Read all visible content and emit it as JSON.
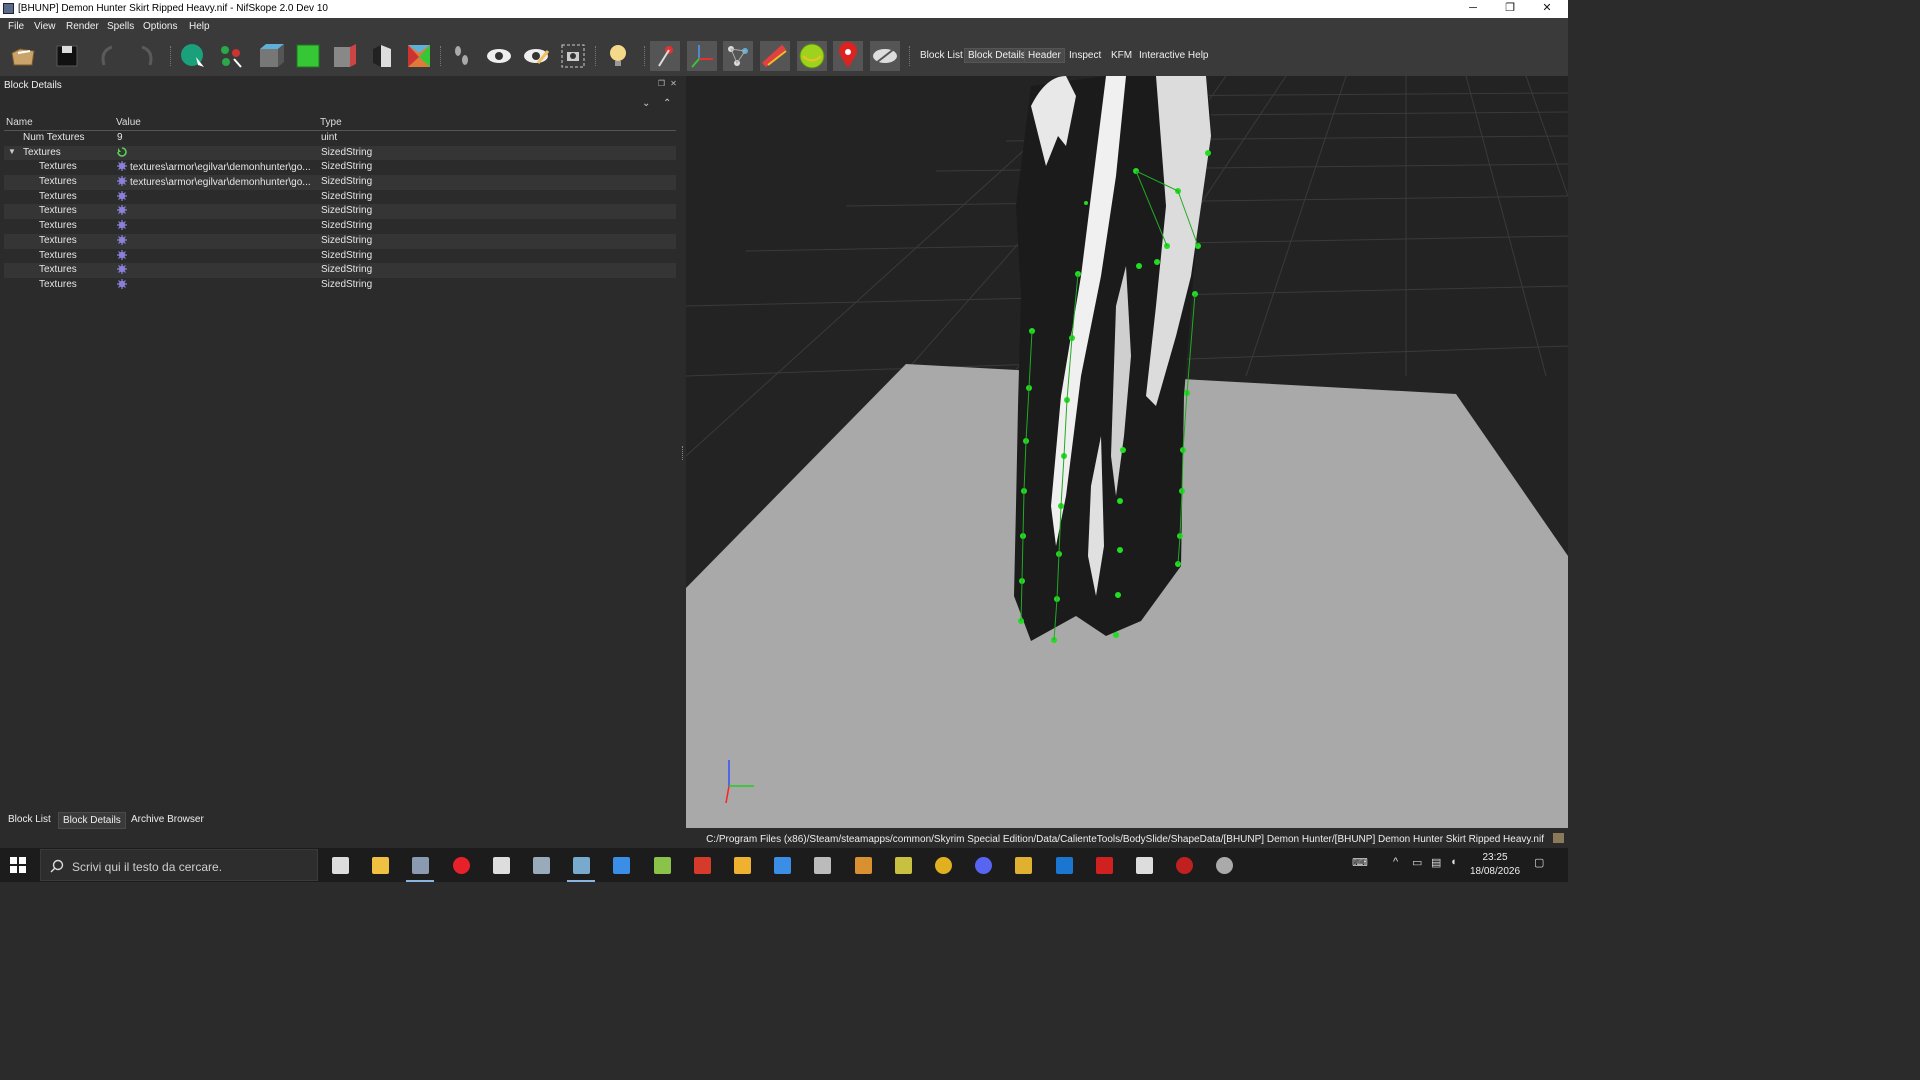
{
  "window": {
    "title": "[BHUNP] Demon Hunter Skirt Ripped Heavy.nif - NifSkope 2.0 Dev 10",
    "minimize": "─",
    "restore": "❐",
    "close": "✕"
  },
  "menu": [
    "File",
    "View",
    "Render",
    "Spells",
    "Options",
    "Help"
  ],
  "toolbar": {
    "icons": [
      {
        "name": "load-icon",
        "color": "#c9a36a"
      },
      {
        "name": "save-icon",
        "color": "#111111"
      },
      {
        "name": "undo-icon",
        "color": "#5a5a5a"
      },
      {
        "name": "redo-icon",
        "color": "#5a5a5a"
      },
      {
        "name": "select-object-icon",
        "color": "#1aa07a"
      },
      {
        "name": "select-vertex-icon",
        "color": "#2aa84a"
      },
      {
        "name": "view-top-icon",
        "color": "#5fb0d8"
      },
      {
        "name": "view-front-icon",
        "color": "#35c735"
      },
      {
        "name": "view-side-icon",
        "color": "#c44"
      },
      {
        "name": "view-user-icon",
        "color": "#ddd"
      },
      {
        "name": "view-walk-icon",
        "color": "#e07a3a"
      },
      {
        "name": "footsteps-icon",
        "color": "#bbb"
      },
      {
        "name": "eye-icon",
        "color": "#eee"
      },
      {
        "name": "eye-edit-icon",
        "color": "#f0c060"
      },
      {
        "name": "screenshot-icon",
        "color": "#ccc"
      },
      {
        "name": "light-bulb-icon",
        "color": "#f5d98a"
      },
      {
        "name": "pin-icon",
        "color": "#d33"
      },
      {
        "name": "axes-icon",
        "color": "#4a8ad0"
      },
      {
        "name": "nodes-icon",
        "color": "#ccc"
      },
      {
        "name": "constraints-icon",
        "color": "#e04040"
      },
      {
        "name": "collision-icon",
        "color": "#9dd21e"
      },
      {
        "name": "marker-icon",
        "color": "#d22"
      },
      {
        "name": "hidden-icon",
        "color": "#ddd"
      }
    ],
    "text_buttons": [
      "Block List",
      "Block Details",
      "Header",
      "Inspect",
      "KFM",
      "Interactive Help"
    ]
  },
  "block_details": {
    "title": "Block Details",
    "columns": [
      "Name",
      "Value",
      "Type"
    ],
    "rows": [
      {
        "name": "Num Textures",
        "value": "9",
        "type": "uint",
        "level": 1,
        "icon": ""
      },
      {
        "name": "Textures",
        "value": "",
        "type": "SizedString",
        "level": 1,
        "icon": "refresh-icon",
        "expanded": true
      },
      {
        "name": "Textures",
        "value": "textures\\armor\\egilvar\\demonhunter\\go...",
        "type": "SizedString",
        "level": 2,
        "icon": "gear-icon"
      },
      {
        "name": "Textures",
        "value": "textures\\armor\\egilvar\\demonhunter\\go...",
        "type": "SizedString",
        "level": 2,
        "icon": "gear-icon"
      },
      {
        "name": "Textures",
        "value": "",
        "type": "SizedString",
        "level": 2,
        "icon": "gear-icon"
      },
      {
        "name": "Textures",
        "value": "",
        "type": "SizedString",
        "level": 2,
        "icon": "gear-icon"
      },
      {
        "name": "Textures",
        "value": "",
        "type": "SizedString",
        "level": 2,
        "icon": "gear-icon"
      },
      {
        "name": "Textures",
        "value": "",
        "type": "SizedString",
        "level": 2,
        "icon": "gear-icon"
      },
      {
        "name": "Textures",
        "value": "",
        "type": "SizedString",
        "level": 2,
        "icon": "gear-icon"
      },
      {
        "name": "Textures",
        "value": "",
        "type": "SizedString",
        "level": 2,
        "icon": "gear-icon"
      },
      {
        "name": "Textures",
        "value": "",
        "type": "SizedString",
        "level": 2,
        "icon": "gear-icon"
      }
    ]
  },
  "bottom_tabs": [
    "Block List",
    "Block Details",
    "Archive Browser"
  ],
  "active_bottom_tab": 1,
  "status_path": "C:/Program Files (x86)/Steam/steamapps/common/Skyrim Special Edition/Data/CalienteTools/BodySlide/ShapeData/[BHUNP] Demon Hunter/[BHUNP] Demon Hunter Skirt Ripped Heavy.nif",
  "taskbar": {
    "search_placeholder": "Scrivi qui il testo da cercare.",
    "apps": [
      {
        "name": "task-view-icon",
        "color": "#ddd"
      },
      {
        "name": "file-explorer-icon",
        "color": "#f0c040"
      },
      {
        "name": "nifskope-icon",
        "color": "#8a9ab0",
        "running": true
      },
      {
        "name": "opera-icon",
        "color": "#e8202a"
      },
      {
        "name": "nvidia-icon",
        "color": "#ddd"
      },
      {
        "name": "pen-icon",
        "color": "#9ab"
      },
      {
        "name": "paint-icon",
        "color": "#7ac",
        "running": true
      },
      {
        "name": "windows-store-icon",
        "color": "#3a8ee6"
      },
      {
        "name": "notepad-icon",
        "color": "#8bc34a"
      },
      {
        "name": "filezilla-icon",
        "color": "#d53a2a"
      },
      {
        "name": "arrow-app-icon",
        "color": "#f0b030"
      },
      {
        "name": "window-app-icon",
        "color": "#3a8ee6"
      },
      {
        "name": "terminal-app-icon",
        "color": "#bbb"
      },
      {
        "name": "character-app-icon",
        "color": "#d89030"
      },
      {
        "name": "image-app-icon",
        "color": "#c8c040"
      },
      {
        "name": "chrome-icon",
        "color": "#e0b020"
      },
      {
        "name": "discord-icon",
        "color": "#5865f2"
      },
      {
        "name": "archive-app-icon",
        "color": "#e0b030"
      },
      {
        "name": "blue-square-app-icon",
        "color": "#1b76d2"
      },
      {
        "name": "red-arrow-app-icon",
        "color": "#d02020"
      },
      {
        "name": "grid-app-icon",
        "color": "#ddd"
      },
      {
        "name": "red-target-app-icon",
        "color": "#c02020"
      },
      {
        "name": "steam-app-icon",
        "color": "#aaa"
      }
    ],
    "time": "23:25",
    "date": "18/08/2026"
  }
}
